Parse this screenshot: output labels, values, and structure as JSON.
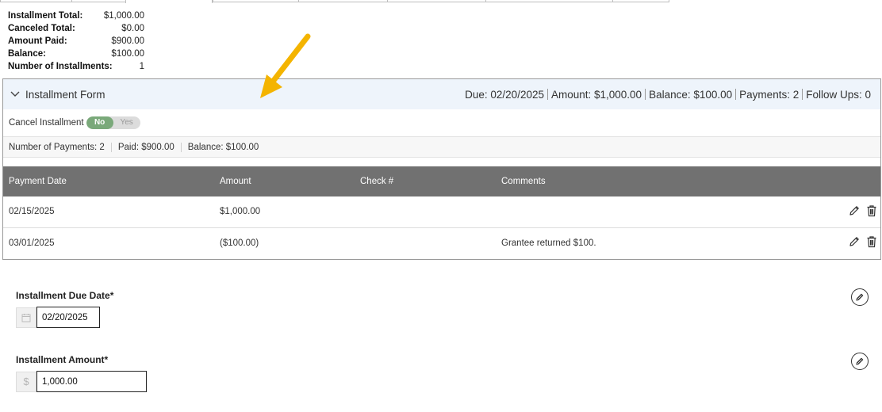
{
  "totals": [
    {
      "label": "Installment Total:",
      "value": "$1,000.00"
    },
    {
      "label": "Canceled Total:",
      "value": "$0.00"
    },
    {
      "label": "Amount Paid:",
      "value": "$900.00"
    },
    {
      "label": "Balance:",
      "value": "$100.00"
    },
    {
      "label": "Number of Installments:",
      "value": "1"
    }
  ],
  "panel": {
    "title": "Installment Form",
    "summary": {
      "due": "Due: 02/20/2025",
      "amount": "Amount: $1,000.00",
      "balance": "Balance: $100.00",
      "payments": "Payments: 2",
      "followups": "Follow Ups: 0"
    },
    "cancel": {
      "label": "Cancel Installment",
      "no": "No",
      "yes": "Yes",
      "selected": "No"
    },
    "stats": {
      "num_payments": "Number of Payments: 2",
      "paid": "Paid: $900.00",
      "balance": "Balance: $100.00"
    }
  },
  "payments_table": {
    "columns": [
      "Payment Date",
      "Amount",
      "Check #",
      "Comments"
    ],
    "rows": [
      {
        "date": "02/15/2025",
        "amount": "$1,000.00",
        "check": "",
        "comments": ""
      },
      {
        "date": "03/01/2025",
        "amount": "($100.00)",
        "check": "",
        "comments": "Grantee returned $100."
      }
    ]
  },
  "form": {
    "due_date": {
      "label": "Installment Due Date*",
      "value": "02/20/2025"
    },
    "amount": {
      "label": "Installment Amount*",
      "value": "1,000.00",
      "prefix": "$"
    }
  },
  "icons": {
    "collapse": "chevron-down-icon",
    "edit": "pencil-icon",
    "delete": "trash-icon",
    "calendar": "calendar-icon"
  },
  "colors": {
    "header_bg": "#eef4fb",
    "table_header": "#717171",
    "toggle_on": "#7aa97a",
    "annotation_arrow": "#f4b400"
  }
}
